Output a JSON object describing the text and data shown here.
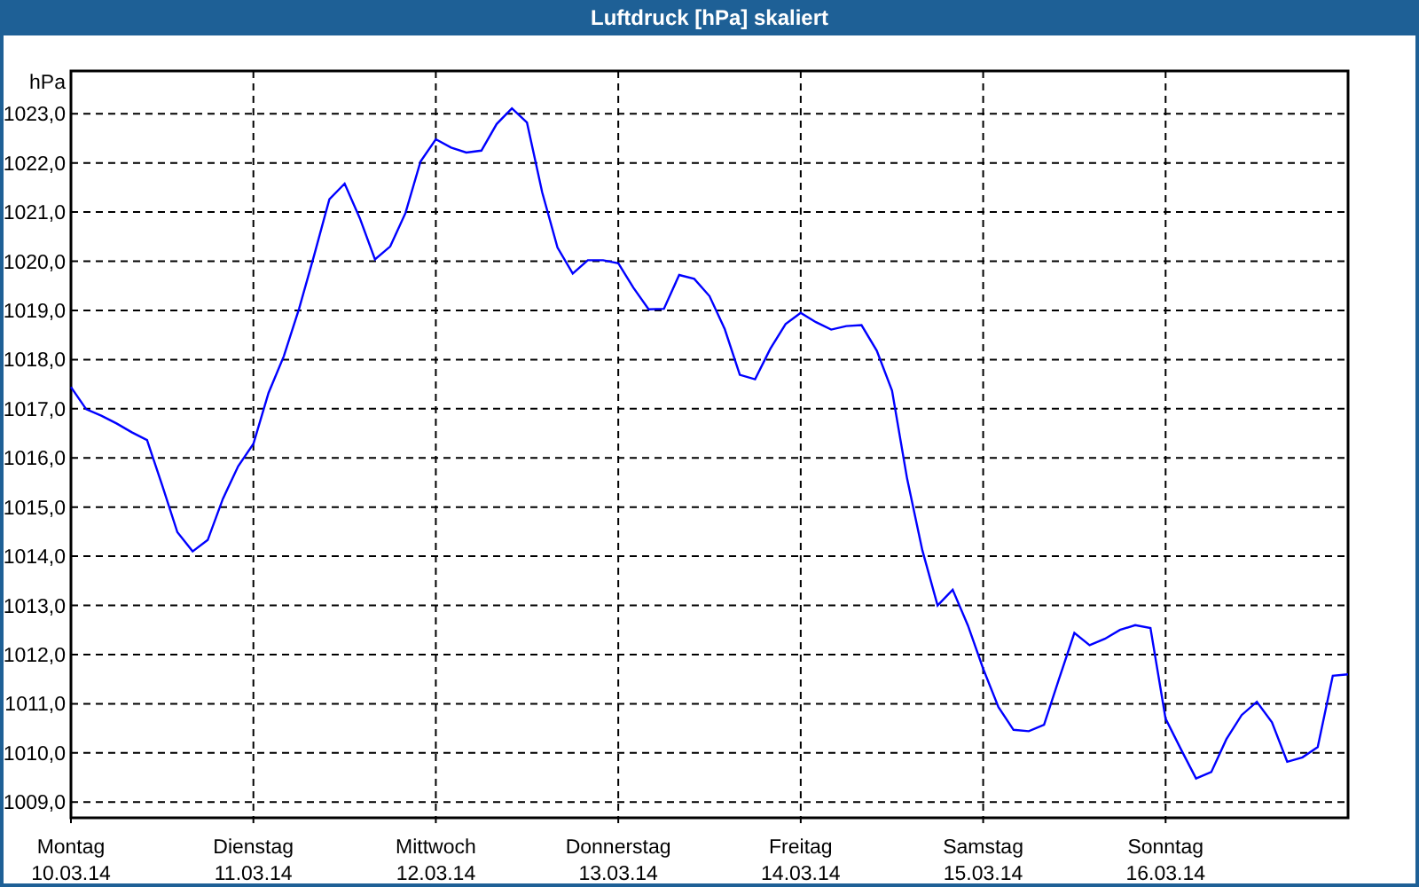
{
  "chart_data": {
    "type": "line",
    "title": "Luftdruck [hPa] skaliert",
    "ylabel": "hPa",
    "grid": true,
    "ylim": [
      1008.68,
      1023.87
    ],
    "yticks": [
      {
        "value": 1009,
        "label": "1009,0"
      },
      {
        "value": 1010,
        "label": "1010,0"
      },
      {
        "value": 1011,
        "label": "1011,0"
      },
      {
        "value": 1012,
        "label": "1012,0"
      },
      {
        "value": 1013,
        "label": "1013,0"
      },
      {
        "value": 1014,
        "label": "1014,0"
      },
      {
        "value": 1015,
        "label": "1015,0"
      },
      {
        "value": 1016,
        "label": "1016,0"
      },
      {
        "value": 1017,
        "label": "1017,0"
      },
      {
        "value": 1018,
        "label": "1018,0"
      },
      {
        "value": 1019,
        "label": "1019,0"
      },
      {
        "value": 1020,
        "label": "1020,0"
      },
      {
        "value": 1021,
        "label": "1021,0"
      },
      {
        "value": 1022,
        "label": "1022,0"
      },
      {
        "value": 1023,
        "label": "1023,0"
      }
    ],
    "categories": [
      "Montag\n10.03.14",
      null,
      null,
      null,
      null,
      null,
      null,
      null,
      null,
      null,
      null,
      null,
      "Dienstag\n11.03.14",
      null,
      null,
      null,
      null,
      null,
      null,
      null,
      null,
      null,
      null,
      null,
      "Mittwoch\n12.03.14",
      null,
      null,
      null,
      null,
      null,
      null,
      null,
      null,
      null,
      null,
      null,
      "Donnerstag\n13.03.14",
      null,
      null,
      null,
      null,
      null,
      null,
      null,
      null,
      null,
      null,
      null,
      "Freitag\n14.03.14",
      null,
      null,
      null,
      null,
      null,
      null,
      null,
      null,
      null,
      null,
      null,
      "Samstag\n15.03.14",
      null,
      null,
      null,
      null,
      null,
      null,
      null,
      null,
      null,
      null,
      null,
      "Sonntag\n16.03.14",
      null,
      null,
      null,
      null,
      null,
      null,
      null,
      null,
      null,
      null,
      null,
      null
    ],
    "series": [
      {
        "color": "#0000ff",
        "values": [
          1017.44,
          1016.99,
          1016.86,
          1016.7,
          1016.52,
          1016.36,
          1015.45,
          1014.49,
          1014.1,
          1014.33,
          1015.17,
          1015.83,
          1016.29,
          1017.32,
          1018.07,
          1019.03,
          1020.12,
          1021.26,
          1021.58,
          1020.87,
          1020.04,
          1020.3,
          1020.98,
          1022.03,
          1022.48,
          1022.31,
          1022.21,
          1022.25,
          1022.79,
          1023.11,
          1022.82,
          1021.4,
          1020.28,
          1019.75,
          1020.02,
          1020.02,
          1019.96,
          1019.46,
          1019.02,
          1019.03,
          1019.72,
          1019.64,
          1019.29,
          1018.62,
          1017.69,
          1017.6,
          1018.22,
          1018.72,
          1018.95,
          1018.76,
          1018.61,
          1018.68,
          1018.7,
          1018.18,
          1017.37,
          1015.58,
          1014.12,
          1013.0,
          1013.32,
          1012.59,
          1011.71,
          1010.93,
          1010.47,
          1010.44,
          1010.57,
          1011.51,
          1012.44,
          1012.19,
          1012.32,
          1012.5,
          1012.6,
          1012.54,
          1010.7,
          1010.08,
          1009.48,
          1009.61,
          1010.28,
          1010.77,
          1011.04,
          1010.62,
          1009.82,
          1009.91,
          1010.12,
          1011.57,
          1011.6
        ]
      }
    ]
  }
}
